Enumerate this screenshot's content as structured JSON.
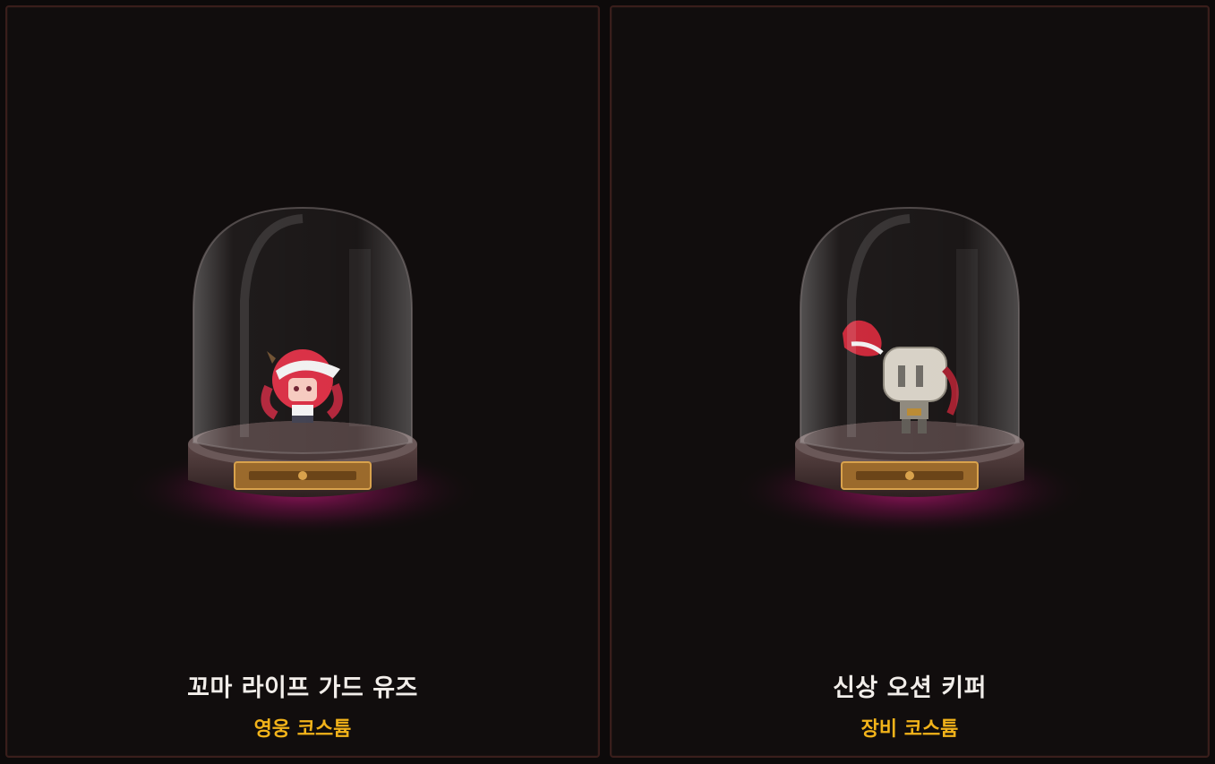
{
  "colors": {
    "background": "#0d0a0a",
    "card_border": "#3a1e1b",
    "name_text": "#f2eeea",
    "category_text": "#f2b31a",
    "glow": "#c2187a"
  },
  "cards": [
    {
      "name": "꼬마 라이프 가드 유즈",
      "category": "영웅 코스튬",
      "icon": "glass-dome-costume-preview"
    },
    {
      "name": "신상 오션 키퍼",
      "category": "장비 코스튬",
      "icon": "glass-dome-costume-preview"
    }
  ]
}
